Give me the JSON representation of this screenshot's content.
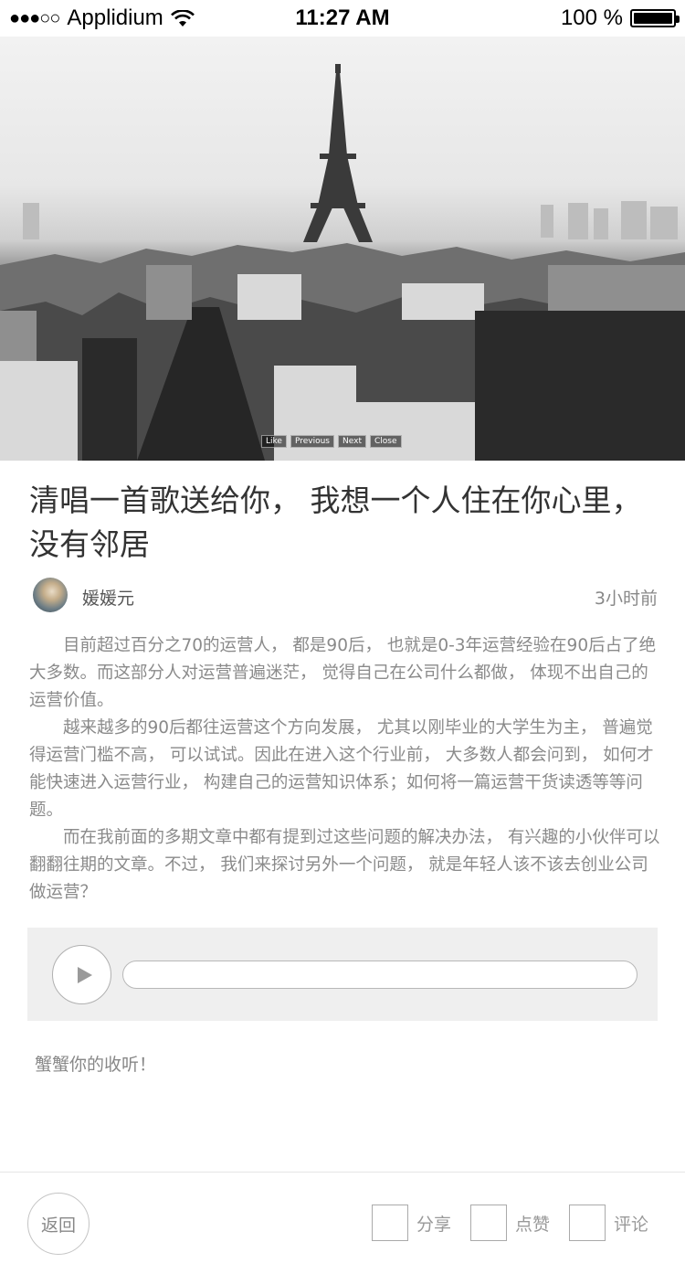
{
  "status_bar": {
    "signal": "●●●○○",
    "carrier": "Applidium",
    "time": "11:27 AM",
    "battery_text": "100 %",
    "battery_level": 1.0
  },
  "hero": {
    "icon": "eiffel-tower-photo",
    "controls": [
      "Like",
      "Previous",
      "Next",
      "Close"
    ]
  },
  "article": {
    "title": "清唱一首歌送给你， 我想一个人住在你心里， 没有邻居",
    "author": "媛媛元",
    "time_ago": "3小时前",
    "paragraphs": [
      "目前超过百分之70的运营人， 都是90后， 也就是0-3年运营经验在90后占了绝大多数。而这部分人对运营普遍迷茫， 觉得自己在公司什么都做， 体现不出自己的运营价值。",
      "越来越多的90后都往运营这个方向发展， 尤其以刚毕业的大学生为主， 普遍觉得运营门槛不高， 可以试试。因此在进入这个行业前， 大多数人都会问到， 如何才能快速进入运营行业， 构建自己的运营知识体系；如何将一篇运营干货读透等等问题。",
      "而在我前面的多期文章中都有提到过这些问题的解决办法， 有兴趣的小伙伴可以翻翻往期的文章。不过， 我们来探讨另外一个问题， 就是年轻人该不该去创业公司做运营？"
    ]
  },
  "player": {
    "progress": 0.0
  },
  "thanks_text": "蟹蟹你的收听！",
  "bottom_bar": {
    "back_label": "返回",
    "share_label": "分享",
    "like_label": "点赞",
    "comment_label": "评论"
  }
}
